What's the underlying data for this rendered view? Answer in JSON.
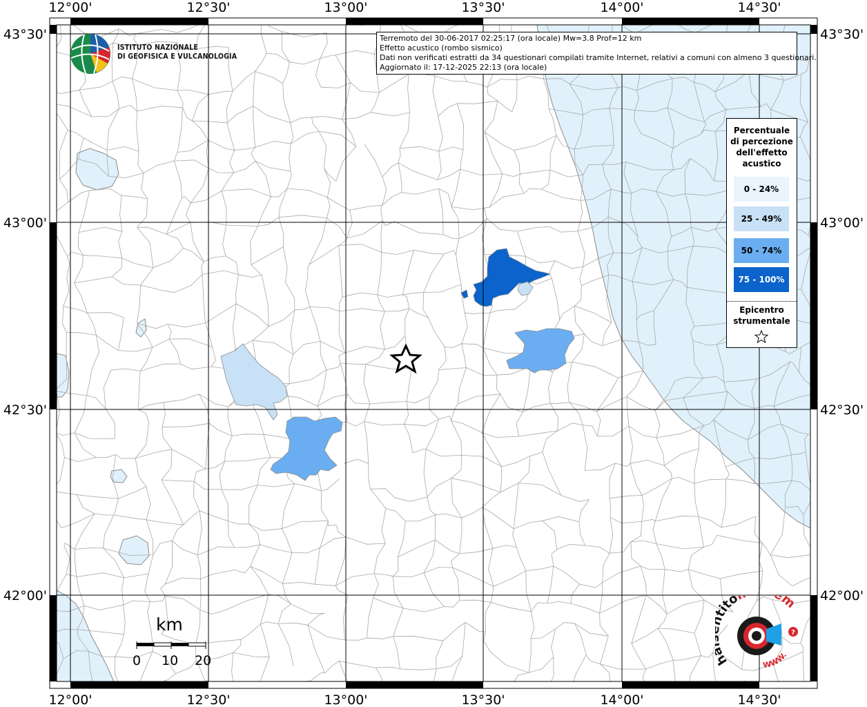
{
  "map": {
    "lon_ticks": [
      "12°00'",
      "12°30'",
      "13°00'",
      "13°30'",
      "14°00'",
      "14°30'"
    ],
    "lat_ticks": [
      "43°30'",
      "43°00'",
      "42°30'",
      "42°00'"
    ],
    "sea_color": "#e1f1fb",
    "border_color": "#8a8a8a"
  },
  "header": {
    "line1": "Terremoto del 30-06-2017 02:25:17 (ora locale) Mw=3.8 Prof=12 km",
    "line2": "Effetto acustico (rombo sismico)",
    "line3": "Dati non verificati estratti da 34 questionari compilati tramite Internet, relativi a comuni con almeno 3 questionari.",
    "line4": "Aggiornato il: 17-12-2025 22:13 (ora locale)"
  },
  "institute": {
    "line1": "ISTITUTO NAZIONALE",
    "line2": "DI GEOFISICA E VULCANOLOGIA"
  },
  "legend": {
    "title_line1": "Percentuale",
    "title_line2": "di percezione",
    "title_line3": "dell'effetto",
    "title_line4": "acustico",
    "classes": [
      {
        "label": "0 - 24%",
        "color": "#e9f4fd"
      },
      {
        "label": "25 - 49%",
        "color": "#c8e1f6"
      },
      {
        "label": "50 - 74%",
        "color": "#6aaef1"
      },
      {
        "label": "75 - 100%",
        "color": "#0b63cb"
      }
    ],
    "epicenter_line1": "Epicentro",
    "epicenter_line2": "strumentale"
  },
  "scale": {
    "unit": "km",
    "labels": [
      "0",
      "10",
      "20"
    ]
  },
  "logo": {
    "text_main": "haisentito",
    "text_site": "ilterremoto.it",
    "text_www": "WWW."
  },
  "areas": [
    {
      "name": "area-75-100",
      "class_index": 3
    },
    {
      "name": "area-25-49-west",
      "class_index": 1
    },
    {
      "name": "area-50-74-south",
      "class_index": 2
    },
    {
      "name": "area-50-74-east",
      "class_index": 2
    },
    {
      "name": "area-25-49-small",
      "class_index": 1
    }
  ]
}
